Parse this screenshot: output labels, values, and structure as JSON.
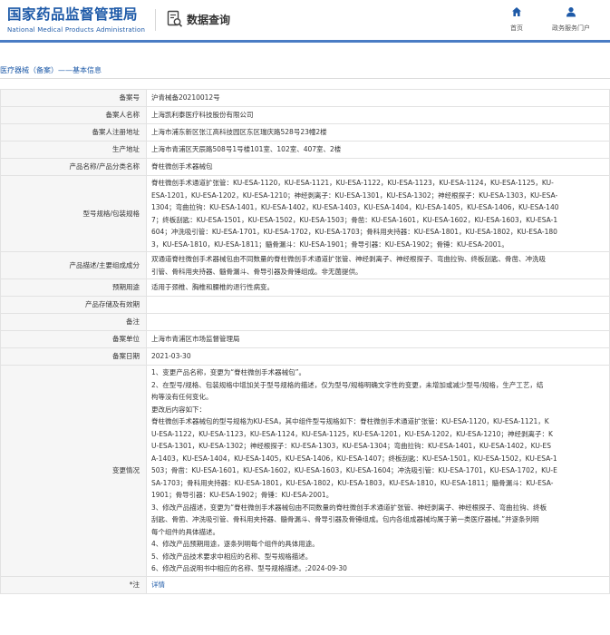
{
  "header": {
    "brand_cn": "国家药品监督管理局",
    "brand_en": "National Medical Products Administration",
    "query_title": "数据查询",
    "nav": [
      {
        "label": "首页",
        "icon": "home-icon"
      },
      {
        "label": "政务服务门户",
        "icon": "user-icon"
      }
    ],
    "brand_color": "#1e5aa8"
  },
  "breadcrumb": "医疗器械（备案）——基本信息",
  "record": {
    "filing_no": {
      "label": "备案号",
      "value": "沪青械备20210012号"
    },
    "filer_name": {
      "label": "备案人名称",
      "value": "上海凯利泰医疗科技股份有限公司"
    },
    "filer_address": {
      "label": "备案人注册地址",
      "value": "上海市浦东新区张江高科技园区东区瑞庆路528号23幢2楼"
    },
    "production_address": {
      "label": "生产地址",
      "value": "上海市青浦区天辰路508号1号楼101室、102室、407室、2楼"
    },
    "product_name": {
      "label": "产品名称/产品分类名称",
      "value": "脊柱微创手术器械包"
    },
    "models": {
      "label": "型号规格/包装规格",
      "lines": [
        "脊柱微创手术通道扩张管：KU-ESA-1120，KU-ESA-1121，KU-ESA-1122，KU-ESA-1123，KU-ESA-1124，KU-ESA-1125，KU-",
        "ESA-1201，KU-ESA-1202，KU-ESA-1210；神经剥离子：KU-ESA-1301，KU-ESA-1302；神经根探子：KU-ESA-1303，KU-ESA-",
        "1304；弯曲拉钩：KU-ESA-1401，KU-ESA-1402，KU-ESA-1403，KU-ESA-1404，KU-ESA-1405，KU-ESA-1406，KU-ESA-140",
        "7；终板刮匙：KU-ESA-1501，KU-ESA-1502，KU-ESA-1503；骨凿：KU-ESA-1601，KU-ESA-1602，KU-ESA-1603，KU-ESA-1",
        "604；冲洗吸引管：KU-ESA-1701，KU-ESA-1702，KU-ESA-1703；骨科用夹持器：KU-ESA-1801，KU-ESA-1802，KU-ESA-180",
        "3，KU-ESA-1810，KU-ESA-1811；髓骨漏斗：KU-ESA-1901；骨导引器：KU-ESA-1902；骨锤：KU-ESA-2001。"
      ]
    },
    "description": {
      "label": "产品描述/主要组成成分",
      "lines": [
        "双通道脊柱微创手术器械包由不同数量的脊柱微创手术通道扩张管、神经剥离子、神经根探子、弯曲拉钩、终板刮匙、骨凿、冲洗吸",
        "引管、骨科用夹持器、髓骨漏斗、骨导引器及骨锤组成。非无菌提供。"
      ]
    },
    "intended_use": {
      "label": "预期用途",
      "value": "适用于颈椎、胸椎和腰椎的退行性病变。"
    },
    "storage": {
      "label": "产品存储及有效期",
      "value": ""
    },
    "remarks": {
      "label": "备注",
      "value": ""
    },
    "filing_unit": {
      "label": "备案单位",
      "value": "上海市青浦区市场监督管理局"
    },
    "filing_date": {
      "label": "备案日期",
      "value": "2021-03-30"
    },
    "changes": {
      "label": "变更情况",
      "lines": [
        "1、变更产品名称，变更为“脊柱微创手术器械包”。",
        "2、在型号/规格、包装规格中增加关于型号规格的描述，仅为型号/规格明确文字性的变更，未增加或减少型号/规格，生产工艺，结",
        "构等没有任何变化。",
        "更改后内容如下：",
        "脊柱微创手术器械包的型号规格为KU-ESA，其中组件型号规格如下：脊柱微创手术通道扩张管：KU-ESA-1120，KU-ESA-1121，K",
        "U-ESA-1122，KU-ESA-1123，KU-ESA-1124，KU-ESA-1125，KU-ESA-1201，KU-ESA-1202，KU-ESA-1210；神经剥离子：K",
        "U-ESA-1301，KU-ESA-1302；神经根探子：KU-ESA-1303，KU-ESA-1304；弯曲拉钩：KU-ESA-1401，KU-ESA-1402，KU-ES",
        "A-1403，KU-ESA-1404，KU-ESA-1405，KU-ESA-1406，KU-ESA-1407；终板刮匙：KU-ESA-1501，KU-ESA-1502，KU-ESA-1",
        "503；骨凿：KU-ESA-1601，KU-ESA-1602，KU-ESA-1603，KU-ESA-1604；冲洗吸引管：KU-ESA-1701，KU-ESA-1702，KU-E",
        "SA-1703；骨科用夹持器：KU-ESA-1801，KU-ESA-1802，KU-ESA-1803，KU-ESA-1810，KU-ESA-1811；髓骨漏斗：KU-ESA-",
        "1901；骨导引器：KU-ESA-1902；骨锤：KU-ESA-2001。",
        "3、修改产品描述，变更为“脊柱微创手术器械包由不同数量的脊柱微创手术通道扩张管、神经剥离子、神经根探子、弯曲拉钩、终板",
        "刮匙、骨凿、冲洗吸引管、骨科用夹持器、髓骨漏斗、骨导引器及骨锤组成。包内各组成器械均属于第一类医疗器械。”并逐条列明",
        "每个组件的具体描述。",
        "4、修改产品预期用途，逐条列明每个组件的具体用途。",
        "5、修改产品技术要求中相应的名称、型号规格描述。",
        "6、修改产品说明书中相应的名称、型号规格描述。;2024-09-30"
      ]
    },
    "notes": {
      "label": "*注",
      "link": "详情"
    }
  }
}
